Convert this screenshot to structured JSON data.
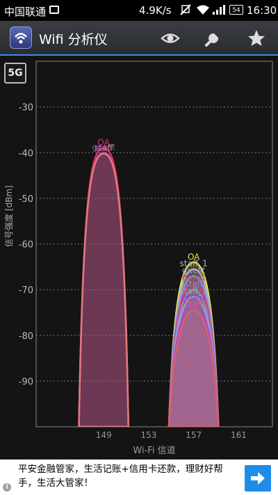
{
  "status_bar": {
    "carrier": "中国联通",
    "speed": "4.9K/s",
    "battery": "54",
    "time": "16:30",
    "icons": [
      "image-icon",
      "mute-icon",
      "wifi-icon",
      "signal-icon",
      "battery-icon"
    ]
  },
  "action_bar": {
    "title": "Wifi 分析仪",
    "icons": [
      "eye-icon",
      "wrench-icon",
      "star-icon"
    ],
    "accent_color": "#3a8de8"
  },
  "band_button": "5G",
  "chart_data": {
    "type": "area",
    "title": "",
    "xlabel": "Wi-Fi 信道",
    "ylabel": "信号强度 [dBm]",
    "xlim": [
      143,
      164
    ],
    "ylim": [
      -100,
      -20
    ],
    "x_ticks": [
      "149",
      "153",
      "157",
      "161"
    ],
    "y_ticks": [
      "-30",
      "-40",
      "-50",
      "-60",
      "-70",
      "-80",
      "-90"
    ],
    "grid": true,
    "series": [
      {
        "name": "guest",
        "channel": 149,
        "peak": -40,
        "color": "#5a5ae0"
      },
      {
        "name": "OA",
        "channel": 149,
        "peak": -39,
        "color": "#e0306a"
      },
      {
        "name": "staff",
        "channel": 149,
        "peak": -40.2,
        "color": "#e07a7a"
      },
      {
        "name": "OA",
        "channel": 157,
        "peak": -64,
        "color": "#e6e040"
      },
      {
        "name": "staff_1",
        "channel": 157,
        "peak": -65.5,
        "color": "#b0b0c8"
      },
      {
        "name": "guest",
        "channel": 157,
        "peak": -67,
        "color": "#9090e0"
      },
      {
        "name": "guest",
        "channel": 157,
        "peak": -68.5,
        "color": "#d04070"
      },
      {
        "name": "staff",
        "channel": 157,
        "peak": -70,
        "color": "#8a8ad0"
      },
      {
        "name": "staff_1",
        "channel": 157,
        "peak": -71.5,
        "color": "#a0a0b8"
      },
      {
        "name": "guest",
        "channel": 157,
        "peak": -73,
        "color": "#b040e0"
      },
      {
        "name": "staff",
        "channel": 157,
        "peak": -74.5,
        "color": "#e06060"
      }
    ]
  },
  "ad": {
    "text": "平安金融管家，生活记账+信用卡还款，理财好帮手，生活大管家！",
    "info": "i"
  }
}
